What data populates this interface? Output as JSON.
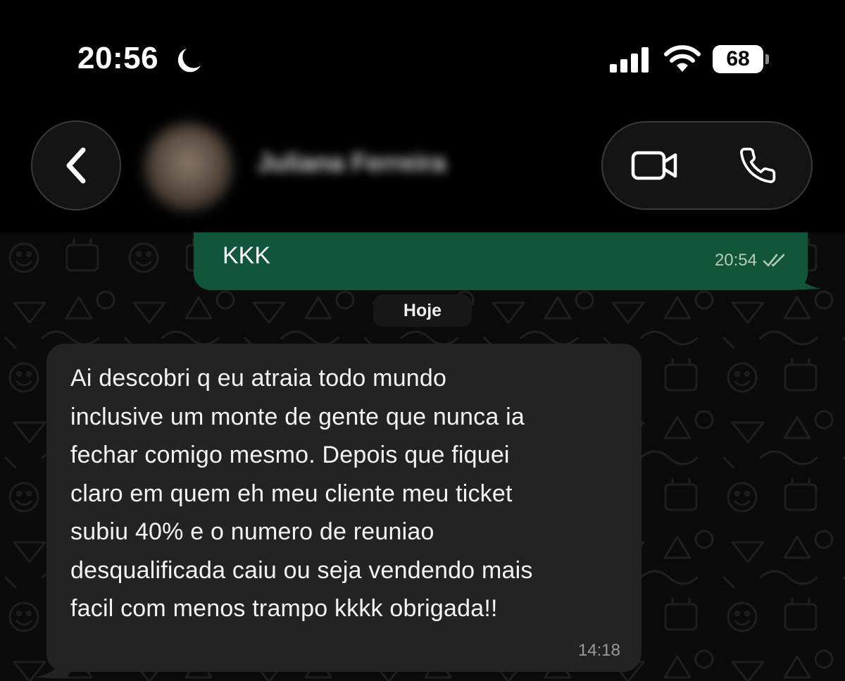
{
  "status_bar": {
    "time": "20:56",
    "battery_level": "68",
    "icons": [
      "moon-icon",
      "signal-icon",
      "wifi-icon",
      "battery-icon"
    ]
  },
  "header": {
    "back_icon": "chevron-left-icon",
    "contact_name": "Juliana Ferreira",
    "video_icon": "video-camera-icon",
    "call_icon": "phone-icon"
  },
  "chat": {
    "outgoing": {
      "text": "KKK",
      "time": "20:54",
      "status_icon": "double-check-icon"
    },
    "date_label": "Hoje",
    "incoming": {
      "text": "Ai descobri q eu atraia todo mundo\ninclusive um monte de gente que nunca ia\nfechar comigo mesmo. Depois que fiquei\nclaro em quem eh meu cliente meu ticket\nsubiu 40% e o numero de reuniao\ndesqualificada caiu ou seja vendendo mais\nfacil com menos trampo kkkk obrigada!!",
      "time": "14:18"
    }
  },
  "colors": {
    "background": "#000000",
    "chat_background": "#0b0b0b",
    "outgoing_bubble": "#11553a",
    "incoming_bubble": "#232323",
    "date_chip": "#181818",
    "button_bg": "#141414"
  }
}
